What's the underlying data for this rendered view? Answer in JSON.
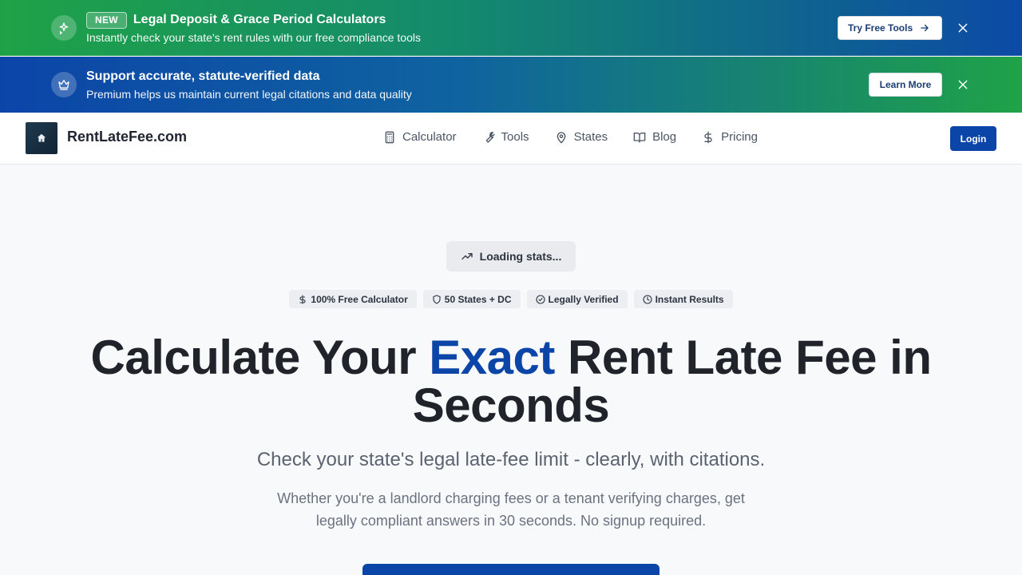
{
  "promo_banner": {
    "badge": "NEW",
    "title": "Legal Deposit & Grace Period Calculators",
    "subtitle": "Instantly check your state's rent rules with our free compliance tools",
    "button_label": "Try Free Tools",
    "icon": "sparkles-icon"
  },
  "support_banner": {
    "title": "Support accurate, statute-verified data",
    "subtitle": "Premium helps us maintain current legal citations and data quality",
    "button_label": "Learn More",
    "icon": "crown-icon"
  },
  "navbar": {
    "brand": "RentLateFee.com",
    "links": [
      {
        "label": "Calculator",
        "icon": "calculator-icon"
      },
      {
        "label": "Tools",
        "icon": "wrench-icon"
      },
      {
        "label": "States",
        "icon": "map-pin-icon"
      },
      {
        "label": "Blog",
        "icon": "book-open-icon"
      },
      {
        "label": "Pricing",
        "icon": "dollar-sign-icon"
      }
    ],
    "login_label": "Login"
  },
  "hero": {
    "stats_label": "Loading stats...",
    "features": [
      {
        "label": "100% Free Calculator",
        "icon": "dollar-sign-icon"
      },
      {
        "label": "50 States + DC",
        "icon": "shield-icon"
      },
      {
        "label": "Legally Verified",
        "icon": "check-circle-icon"
      },
      {
        "label": "Instant Results",
        "icon": "clock-icon"
      }
    ],
    "title_part1": "Calculate Your ",
    "title_accent": "Exact",
    "title_part2": " Rent Late Fee in Seconds",
    "subtitle": "Check your state's legal late-fee limit - clearly, with citations.",
    "description": "Whether you're a landlord charging fees or a tenant verifying charges, get legally compliant answers in 30 seconds. No signup required."
  },
  "colors": {
    "primary": "#0c45a8",
    "green": "#1fa247",
    "text": "#20232a"
  }
}
